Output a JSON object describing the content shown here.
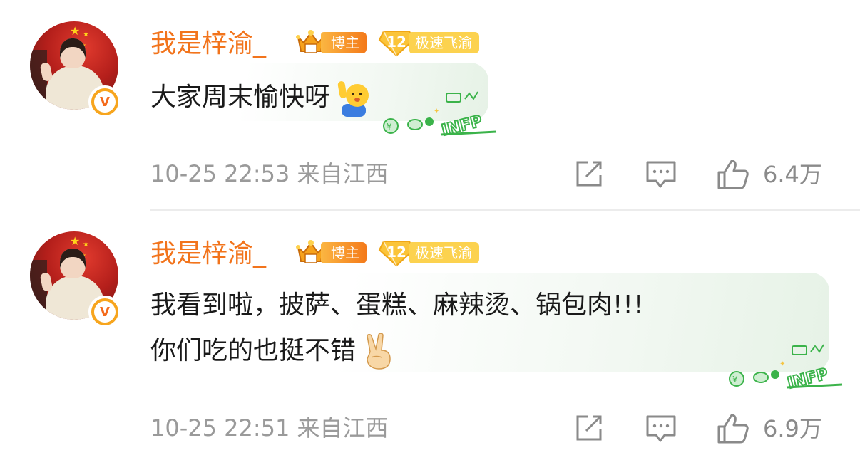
{
  "comments": [
    {
      "username": "我是梓渝_",
      "blogger_badge": "博主",
      "level": "12",
      "level_title": "极速飞渝",
      "verified": "V",
      "text_lines": [
        "大家周末愉快呀"
      ],
      "emoji": "raised-hand-emoji",
      "decoration": "INFP",
      "timestamp": "10-25 22:53",
      "location": "来自江西",
      "likes": "6.4万",
      "icons": {
        "share": "share-icon",
        "reply": "comment-icon",
        "like": "thumbs-up-icon"
      }
    },
    {
      "username": "我是梓渝_",
      "blogger_badge": "博主",
      "level": "12",
      "level_title": "极速飞渝",
      "verified": "V",
      "text_lines": [
        "我看到啦，披萨、蛋糕、麻辣烫、锅包肉!!!",
        "你们吃的也挺不错"
      ],
      "emoji": "victory-hand-emoji",
      "decoration": "INFP",
      "timestamp": "10-25 22:51",
      "location": "来自江西",
      "likes": "6.9万",
      "icons": {
        "share": "share-icon",
        "reply": "comment-icon",
        "like": "thumbs-up-icon"
      }
    }
  ],
  "colors": {
    "username": "#f2741c",
    "meta": "#9a9a9a",
    "text": "#1a1a1a",
    "blogger_badge": "#f47a1a",
    "level_badge": "#fcd24f",
    "verified": "#f7a51d",
    "deco_green": "#3bb34a"
  }
}
